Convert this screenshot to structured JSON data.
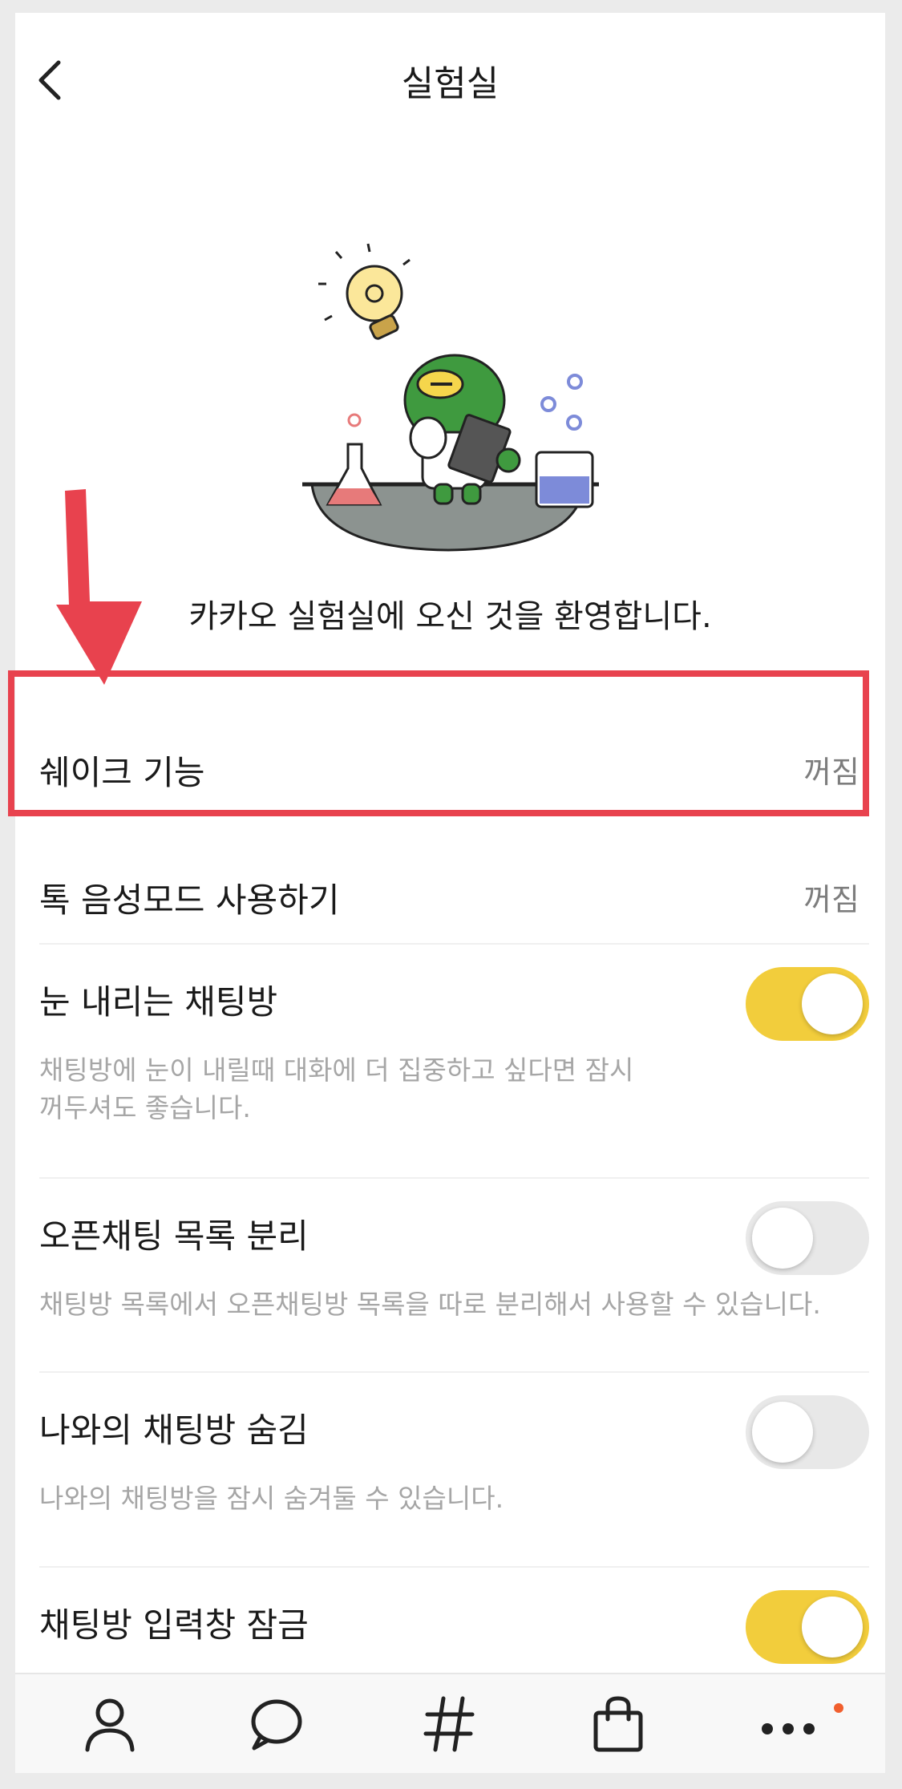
{
  "header": {
    "title": "실험실"
  },
  "welcome": "카카오 실험실에 오신 것을 환영합니다.",
  "items": [
    {
      "label": "쉐이크 기능",
      "value": "꺼짐"
    },
    {
      "label": "톡 음성모드 사용하기",
      "value": "꺼짐"
    },
    {
      "label": "눈 내리는 채팅방",
      "toggle": true,
      "desc_lines": [
        "채팅방에 눈이 내릴때 대화에 더 집중하고 싶다면 잠시",
        "꺼두셔도 좋습니다."
      ]
    },
    {
      "label": "오픈채팅 목록 분리",
      "toggle": false,
      "desc": "채팅방 목록에서 오픈채팅방 목록을 따로 분리해서 사용할 수 있습니다."
    },
    {
      "label": "나와의 채팅방 숨김",
      "toggle": false,
      "desc": "나와의 채팅방을 잠시 숨겨둘 수 있습니다."
    },
    {
      "label": "채팅방 입력창 잠금",
      "toggle": true
    }
  ],
  "tabs": [
    "friends-icon",
    "chats-icon",
    "hashtag-icon",
    "shopping-bag-icon",
    "more-icon"
  ],
  "colors": {
    "toggle_on": "#f2cd3c",
    "highlight": "#e8424e",
    "badge": "#f15f2e"
  }
}
